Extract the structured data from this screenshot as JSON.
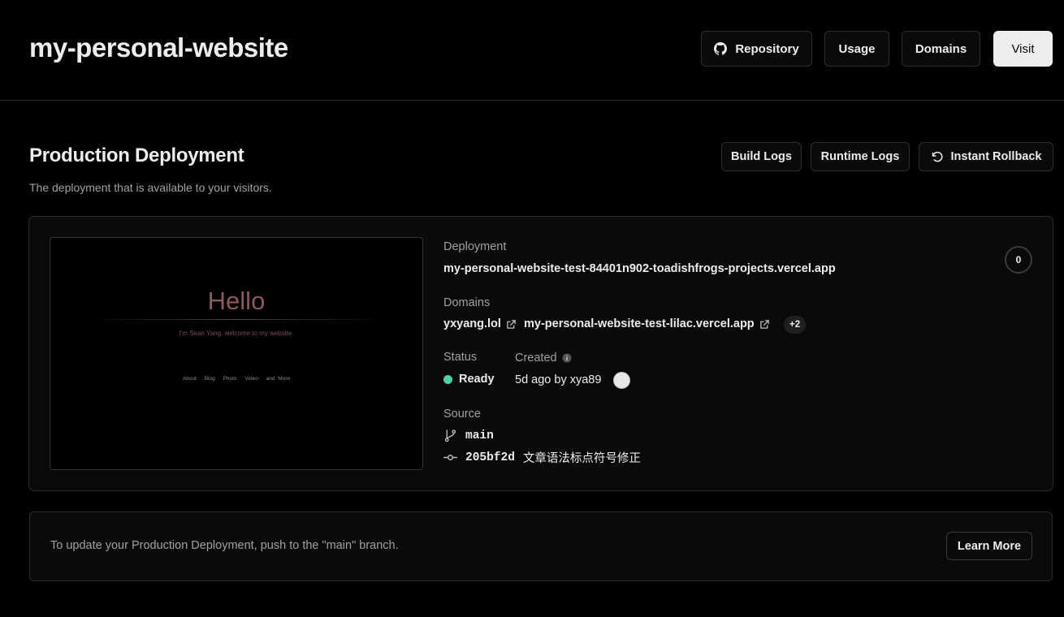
{
  "project": {
    "title": "my-personal-website"
  },
  "header_buttons": {
    "repository": "Repository",
    "usage": "Usage",
    "domains": "Domains",
    "visit": "Visit"
  },
  "production": {
    "title": "Production Deployment",
    "subtitle": "The deployment that is available to your visitors.",
    "build_logs": "Build Logs",
    "runtime_logs": "Runtime Logs",
    "instant_rollback": "Instant Rollback"
  },
  "preview": {
    "hello": "Hello",
    "subtitle": "I'm Sean Yang, welcome to my website.",
    "nav": [
      "About",
      "Blog",
      "Photo",
      "Video",
      "and More"
    ]
  },
  "deployment": {
    "label": "Deployment",
    "url": "my-personal-website-test-84401n902-toadishfrogs-projects.vercel.app",
    "domains_label": "Domains",
    "domain_1": "yxyang.lol",
    "domain_2": "my-personal-website-test-lilac.vercel.app",
    "more_domains": "+2",
    "status_label": "Status",
    "status": "Ready",
    "created_label": "Created",
    "created": "5d ago by xya89",
    "source_label": "Source",
    "branch": "main",
    "commit_hash": "205bf2d",
    "commit_message": "文章语法标点符号修正",
    "count": "0"
  },
  "footer_box": {
    "text": "To update your Production Deployment, push to the \"main\" branch.",
    "learn_more": "Learn More"
  },
  "colors": {
    "background": "#000000",
    "status_ready": "#4fd1a5",
    "visit_button": "#ededed"
  }
}
